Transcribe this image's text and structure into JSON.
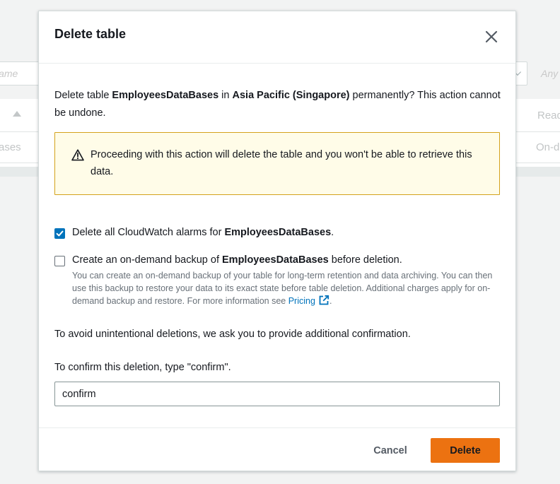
{
  "colors": {
    "primary": "#ec7211",
    "link": "#0073bb",
    "warning_bg": "#fffce8",
    "warning_border": "#d4a21b",
    "checkbox_checked": "#0073bb"
  },
  "background": {
    "filter_placeholder": "Name",
    "select_placeholder": "Any",
    "column_header": "Read",
    "row_name": "ases",
    "row_capacity": "On-d"
  },
  "modal": {
    "title": "Delete table",
    "close_icon": "close-icon",
    "intro": {
      "prefix": "Delete table ",
      "table_name": "EmployeesDataBases",
      "middle": " in ",
      "region": "Asia Pacific (Singapore)",
      "suffix": " permanently? This action cannot be undone."
    },
    "warning": {
      "icon": "warning-icon",
      "text": "Proceeding with this action will delete the table and you won't be able to retrieve this data."
    },
    "delete_alarms": {
      "checked": true,
      "label_prefix": "Delete all CloudWatch alarms for ",
      "table_name": "EmployeesDataBases",
      "label_suffix": "."
    },
    "backup": {
      "checked": false,
      "label_prefix": "Create an on-demand backup of ",
      "table_name": "EmployeesDataBases",
      "label_suffix": " before deletion.",
      "description": "You can create an on-demand backup of your table for long-term retention and data archiving. You can then use this backup to restore your data to its exact state before table deletion. Additional charges apply for on-demand backup and restore. For more information see ",
      "link_text": "Pricing",
      "link_icon": "external-link-icon",
      "description_end": "."
    },
    "confirmation_info": "To avoid unintentional deletions, we ask you to provide additional confirmation.",
    "confirm_label": "To confirm this deletion, type \"confirm\".",
    "confirm_value": "confirm",
    "cancel_label": "Cancel",
    "delete_label": "Delete"
  }
}
